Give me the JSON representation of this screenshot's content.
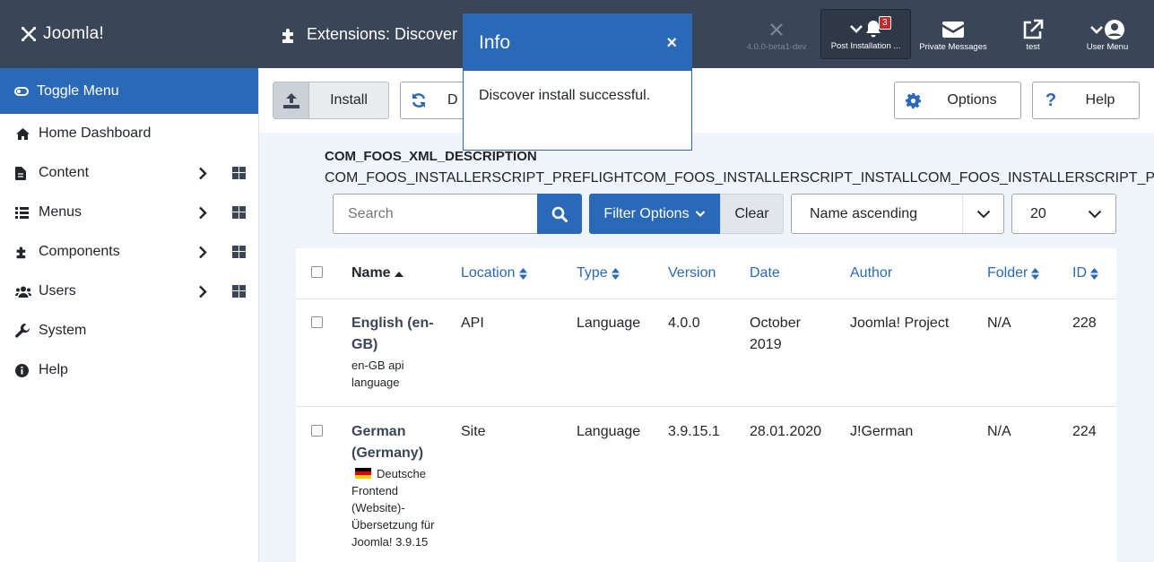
{
  "header": {
    "logo_text": "Joomla!",
    "page_title": "Extensions: Discover",
    "version": "4.0.0-beta1-dev",
    "post_install_label": "Post Installation ...",
    "post_install_count": "3",
    "messages_label": "Private Messages",
    "site_label": "test",
    "user_menu_label": "User Menu"
  },
  "sidebar": {
    "toggle_label": "Toggle Menu",
    "items": [
      {
        "label": "Home Dashboard",
        "icon": "home-icon"
      },
      {
        "label": "Content",
        "icon": "file-icon"
      },
      {
        "label": "Menus",
        "icon": "list-icon"
      },
      {
        "label": "Components",
        "icon": "puzzle-icon"
      },
      {
        "label": "Users",
        "icon": "users-icon"
      },
      {
        "label": "System",
        "icon": "wrench-icon"
      },
      {
        "label": "Help",
        "icon": "info-icon"
      }
    ]
  },
  "toolbar": {
    "install_label": "Install",
    "discover_label": "D",
    "options_label": "Options",
    "help_label": "Help"
  },
  "description": {
    "title": "COM_FOOS_XML_DESCRIPTION",
    "text": "COM_FOOS_INSTALLERSCRIPT_PREFLIGHTCOM_FOOS_INSTALLERSCRIPT_INSTALLCOM_FOOS_INSTALLERSCRIPT_POSTFLIGHT"
  },
  "filters": {
    "search_placeholder": "Search",
    "filter_options_label": "Filter Options",
    "clear_label": "Clear",
    "sort_value": "Name ascending",
    "limit_value": "20"
  },
  "table": {
    "columns": [
      "Name",
      "Location",
      "Type",
      "Version",
      "Date",
      "Author",
      "Folder",
      "ID"
    ],
    "rows": [
      {
        "name": "English (en-GB)",
        "description": "en-GB api language",
        "location": "API",
        "type": "Language",
        "version": "4.0.0",
        "date": "October 2019",
        "author": "Joomla! Project",
        "folder": "N/A",
        "id": "228"
      },
      {
        "name": "German (Germany)",
        "description": "Deutsche Frontend (Website)-Übersetzung für Joomla! 3.9.15",
        "location": "Site",
        "type": "Language",
        "version": "3.9.15.1",
        "date": "28.01.2020",
        "author": "J!German",
        "folder": "N/A",
        "id": "224"
      }
    ]
  },
  "modal": {
    "title": "Info",
    "close": "×",
    "message": "Discover install successful."
  }
}
